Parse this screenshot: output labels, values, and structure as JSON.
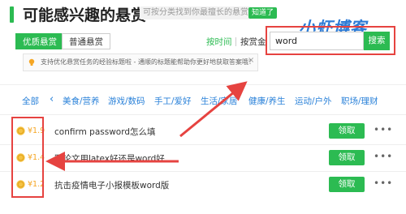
{
  "header": {
    "title": "可能感兴趣的悬赏",
    "subtitle": "可按分类找到你最擅长的悬赏",
    "badge": "知道了"
  },
  "tabs": [
    {
      "label": "优质悬赏",
      "active": true
    },
    {
      "label": "普通悬赏",
      "active": false
    }
  ],
  "sort": {
    "by_time": "按时间",
    "by_reward": "按赏金"
  },
  "search": {
    "value": "word",
    "button": "搜索"
  },
  "watermark": "小虾博客",
  "notice": {
    "text": "支持优化悬赏任务的经验标题啦 - 通顺的标题能帮助你更好地获取答案哦！",
    "close": "×"
  },
  "categories": {
    "all": "全部",
    "items": [
      "美食/营养",
      "游戏/数码",
      "手工/爱好",
      "生活/家居",
      "健康/养生",
      "运动/户外",
      "职场/理财"
    ],
    "prev_icon": "chevron-left-icon"
  },
  "questions": [
    {
      "reward": "¥1.9",
      "title": "confirm password怎么填",
      "action": "领取"
    },
    {
      "reward": "¥1.4",
      "title": "写论文用latex好还是word好",
      "action": "领取"
    },
    {
      "reward": "¥1.2",
      "title": "抗击疫情电子小报模板word版",
      "action": "领取"
    }
  ],
  "more_icon": "more-icon",
  "colors": {
    "accent": "#2cbb52",
    "link": "#2b82d9",
    "reward": "#f5a623",
    "annotation": "#e64340"
  }
}
